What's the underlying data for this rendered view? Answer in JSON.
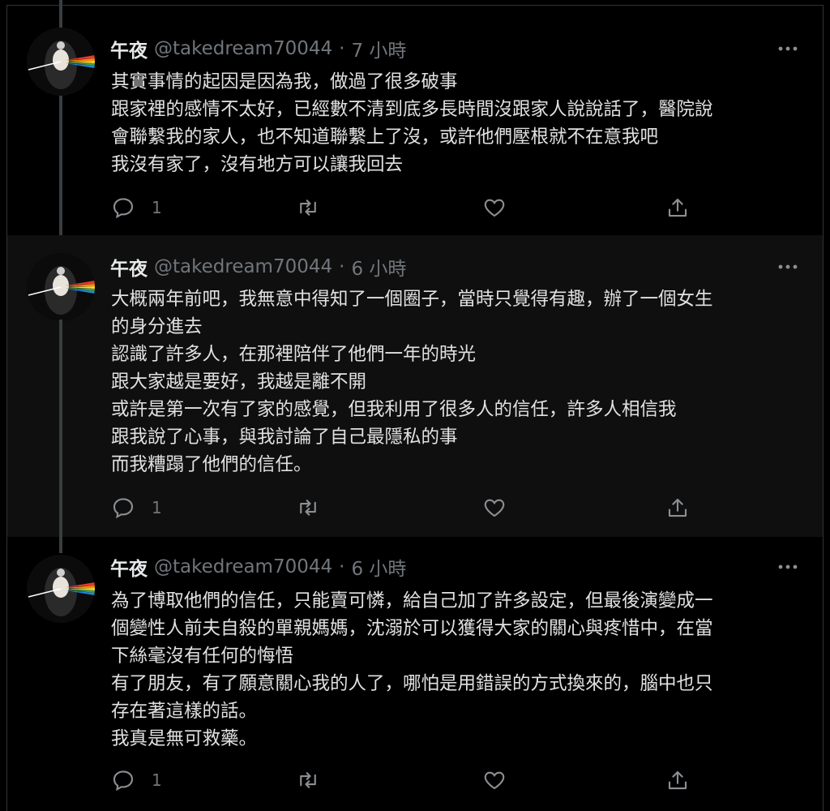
{
  "tweets": [
    {
      "name": "午夜",
      "handle": "@takedream70044",
      "separator": "·",
      "time": "7 小時",
      "lines": [
        "其實事情的起因是因為我，做過了很多破事",
        "跟家裡的感情不太好，已經數不清到底多長時間沒跟家人說說話了，醫院說",
        "會聯繫我的家人，也不知道聯繫上了沒，或許他們壓根就不在意我吧",
        "我沒有家了，沒有地方可以讓我回去"
      ],
      "reply_count": "1",
      "icons": {
        "reply": "reply-icon",
        "retweet": "retweet-icon",
        "like": "heart-icon",
        "share": "share-icon",
        "more": "more-icon"
      }
    },
    {
      "name": "午夜",
      "handle": "@takedream70044",
      "separator": "·",
      "time": "6 小時",
      "lines": [
        "大概兩年前吧，我無意中得知了一個圈子，當時只覺得有趣，辦了一個女生",
        "的身分進去",
        "認識了許多人，在那裡陪伴了他們一年的時光",
        "跟大家越是要好，我越是離不開",
        "或許是第一次有了家的感覺，但我利用了很多人的信任，許多人相信我",
        "跟我說了心事，與我討論了自己最隱私的事",
        "而我糟蹋了他們的信任。"
      ],
      "reply_count": "1",
      "icons": {
        "reply": "reply-icon",
        "retweet": "retweet-icon",
        "like": "heart-icon",
        "share": "share-icon",
        "more": "more-icon"
      }
    },
    {
      "name": "午夜",
      "handle": "@takedream70044",
      "separator": "·",
      "time": "6 小時",
      "lines": [
        "為了博取他們的信任，只能賣可憐，給自己加了許多設定，但最後演變成一",
        "個變性人前夫自殺的單親媽媽，沈溺於可以獲得大家的關心與疼惜中，在當",
        "下絲毫沒有任何的悔悟",
        "有了朋友，有了願意關心我的人了，哪怕是用錯誤的方式換來的，腦中也只",
        "存在著這樣的話。",
        "我真是無可救藥。"
      ],
      "reply_count": "1",
      "icons": {
        "reply": "reply-icon",
        "retweet": "retweet-icon",
        "like": "heart-icon",
        "share": "share-icon",
        "more": "more-icon"
      }
    }
  ],
  "colors": {
    "background": "#000000",
    "highlight": "#0f0f0f",
    "text": "#e1e1e1",
    "muted": "#71767b",
    "thread_line": "#3a3d40"
  }
}
